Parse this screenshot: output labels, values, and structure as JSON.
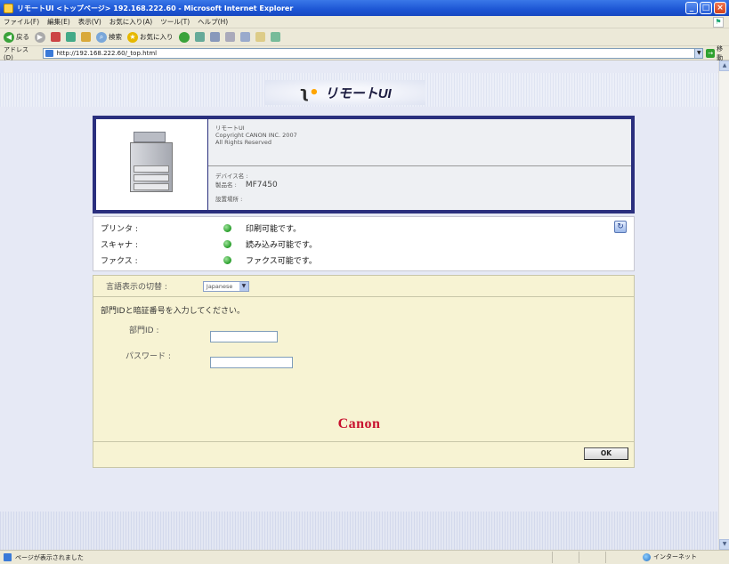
{
  "window": {
    "title": "リモートUI <トップページ> 192.168.222.60 - Microsoft Internet Explorer",
    "minimize": "_",
    "maximize": "□",
    "close": "×"
  },
  "menubar": [
    "ファイル(F)",
    "編集(E)",
    "表示(V)",
    "お気に入り(A)",
    "ツール(T)",
    "ヘルプ(H)"
  ],
  "toolbar": {
    "back": "戻る",
    "search": "検索",
    "favorites": "お気に入り"
  },
  "address": {
    "label": "アドレス(D)",
    "url": "http://192.168.222.60/_top.html",
    "go": "移動"
  },
  "header": {
    "logo_text": "リモートUI"
  },
  "device": {
    "product_line": "リモートUI",
    "copyright": "Copyright CANON INC. 2007",
    "rights": "All Rights Reserved",
    "device_name_label": "デバイス名 :",
    "product_name_label": "製品名 :",
    "product_name_value": "MF7450",
    "location_label": "設置場所 :"
  },
  "status": {
    "items": [
      {
        "label": "プリンタ :",
        "text": "印刷可能です。"
      },
      {
        "label": "スキャナ :",
        "text": "読み込み可能です。"
      },
      {
        "label": "ファクス :",
        "text": "ファクス可能です。"
      }
    ],
    "status_color": "#279d2a"
  },
  "login": {
    "lang_label": "言語表示の切替 :",
    "lang_value": "Japanese",
    "prompt": "部門IDと暗証番号を入力してください。",
    "dept_label": "部門ID :",
    "dept_value": "",
    "password_label": "パスワード :",
    "password_value": "",
    "ok_label": "OK"
  },
  "brand": {
    "name": "Canon",
    "color": "#c8102e"
  },
  "statusbar": {
    "text": "ページが表示されました",
    "zone": "インターネット"
  }
}
